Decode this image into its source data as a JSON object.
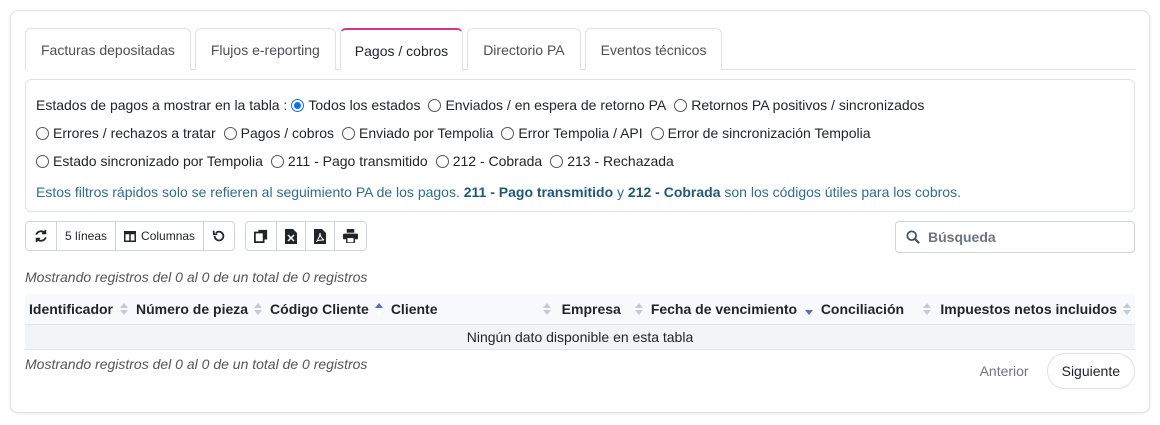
{
  "tabs": [
    {
      "label": "Facturas depositadas",
      "active": false
    },
    {
      "label": "Flujos e-reporting",
      "active": false
    },
    {
      "label": "Pagos / cobros",
      "active": true
    },
    {
      "label": "Directorio PA",
      "active": false
    },
    {
      "label": "Eventos técnicos",
      "active": false
    }
  ],
  "filters": {
    "label": "Estados de pagos a mostrar en la tabla :",
    "options": [
      "Todos los estados",
      "Enviados / en espera de retorno PA",
      "Retornos PA positivos / sincronizados",
      "Errores / rechazos a tratar",
      "Pagos / cobros",
      "Enviado por Tempolia",
      "Error Tempolia / API",
      "Error de sincronización Tempolia",
      "Estado sincronizado por Tempolia",
      "211 - Pago transmitido",
      "212 - Cobrada",
      "213 - Rechazada"
    ],
    "selected": "Todos los estados",
    "note_prefix": "Estos filtros rápidos solo se refieren al seguimiento PA de los pagos.",
    "note_code1": "211 - Pago transmitido",
    "note_and": "y",
    "note_code2": "212 - Cobrada",
    "note_suffix": "son los códigos útiles para los cobros."
  },
  "toolbar": {
    "refresh_icon": "refresh-icon",
    "lines_label": "5 líneas",
    "columns_label": "Columnas",
    "reset_icon": "undo-icon",
    "copy_icon": "copy-icon",
    "excel_icon": "excel-icon",
    "pdf_icon": "pdf-icon",
    "print_icon": "print-icon"
  },
  "search": {
    "placeholder": "Búsqueda"
  },
  "info_top": "Mostrando registros del 0 al 0 de un total de 0 registros",
  "info_bottom": "Mostrando registros del 0 al 0 de un total de 0 registros",
  "table": {
    "columns": [
      "Identificador",
      "Número de pieza",
      "Código Cliente",
      "Cliente",
      "Empresa",
      "Fecha de vencimiento",
      "Conciliación",
      "Impuestos netos incluidos"
    ],
    "empty_message": "Ningún dato disponible en esta tabla"
  },
  "pager": {
    "prev": "Anterior",
    "next": "Siguiente"
  },
  "colors": {
    "accent": "#d63384",
    "radio": "#0d6efd",
    "note": "#2c6e8f"
  }
}
